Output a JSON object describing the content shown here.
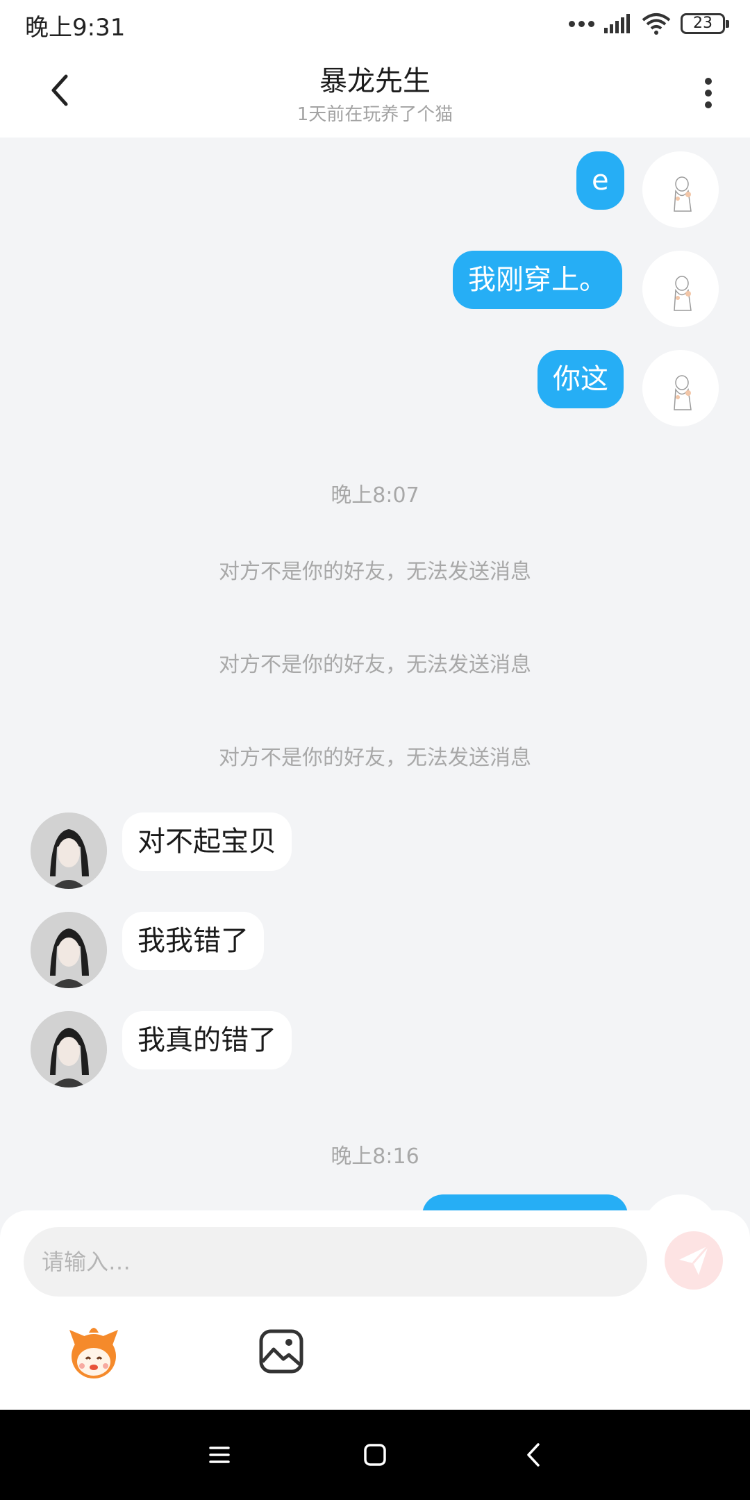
{
  "status_bar": {
    "time": "晚上9:31",
    "battery": "23"
  },
  "header": {
    "title": "暴龙先生",
    "subtitle": "1天前在玩养了个猫"
  },
  "messages": {
    "m1": "e",
    "m2": "我刚穿上。",
    "m3": "你这",
    "time1": "晚上8:07",
    "sys1": "对方不是你的好友，无法发送消息",
    "sys2": "对方不是你的好友，无法发送消息",
    "sys3": "对方不是你的好友，无法发送消息",
    "m4": "对不起宝贝",
    "m5": "我我错了",
    "m6": "我真的错了",
    "time2": "晚上8:16"
  },
  "input": {
    "placeholder": "请输入…"
  },
  "colors": {
    "accent": "#26aef5",
    "background": "#f3f4f6",
    "send_button": "#fde3e3"
  },
  "icons": {
    "back": "chevron-left-icon",
    "more": "more-vertical-icon",
    "send": "paper-plane-icon",
    "emoji": "mascot-emoji-icon",
    "image": "image-icon",
    "nav_menu": "menu-icon",
    "nav_home": "home-square-icon",
    "nav_back": "back-triangle-icon"
  }
}
